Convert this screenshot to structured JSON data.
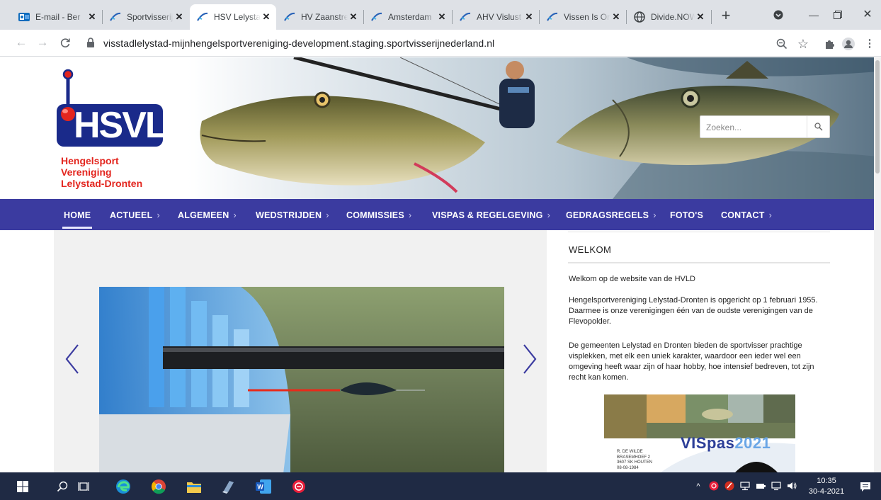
{
  "browser": {
    "tabs": [
      {
        "title": "E-mail - Ber",
        "icon": "outlook-icon"
      },
      {
        "title": "Sportvisserij",
        "icon": "sportvisserij-icon"
      },
      {
        "title": "HSV Lelysta",
        "icon": "sportvisserij-icon",
        "active": true
      },
      {
        "title": "HV Zaanstre",
        "icon": "sportvisserij-icon"
      },
      {
        "title": "Amsterdam",
        "icon": "sportvisserij-icon"
      },
      {
        "title": "AHV Vislust",
        "icon": "sportvisserij-icon"
      },
      {
        "title": "Vissen Is On",
        "icon": "sportvisserij-icon"
      },
      {
        "title": "Divide.NOW",
        "icon": "globe-icon"
      }
    ],
    "new_tab": "+",
    "url": "visstadlelystad-mijnhengelsportvereniging-development.staging.sportvisserijnederland.nl"
  },
  "site": {
    "logo": {
      "letters": "HSVL",
      "line1": "Hengelsport",
      "line2": "Vereniging",
      "line3": "Lelystad-Dronten"
    },
    "search": {
      "placeholder": "Zoeken..."
    },
    "nav": [
      {
        "label": "HOME",
        "has_children": false,
        "active": true
      },
      {
        "label": "ACTUEEL",
        "has_children": true
      },
      {
        "label": "ALGEMEEN",
        "has_children": true
      },
      {
        "label": "WEDSTRIJDEN",
        "has_children": true
      },
      {
        "label": "COMMISSIES",
        "has_children": true
      },
      {
        "label": "VISPAS & REGELGEVING",
        "has_children": true
      },
      {
        "label": "GEDRAGSREGELS",
        "has_children": true
      },
      {
        "label": "FOTO'S",
        "has_children": false
      },
      {
        "label": "CONTACT",
        "has_children": true
      }
    ],
    "nav_chevron": "›",
    "sidebar": {
      "title": "WELKOM",
      "p1": "Welkom op de website van de HVLD",
      "p2": "Hengelsportvereniging Lelystad-Dronten is opgericht op 1 februari 1955. Daarmee is onze verenigingen één van de oudste verenigingen van de Flevopolder.",
      "p3": "De gemeenten Lelystad en Dronten bieden de sportvisser prachtige visplekken, met elk een uniek karakter, waardoor een ieder wel een omgeving heeft waar zijn of haar hobby, hoe intensief bedreven, tot zijn recht kan komen.",
      "vispas": {
        "title_vis": "VISpas",
        "title_year": "2021",
        "holder": [
          "R. DE WILDE",
          "BRASEMHOEF 2",
          "3607 SK  HOUTEN",
          "08-08-1984"
        ]
      }
    },
    "colors": {
      "nav": "#3b3ba0",
      "logo_blue": "#1a2a8a",
      "logo_red": "#e3261f"
    }
  },
  "taskbar": {
    "time": "10:35",
    "date": "30-4-2021"
  }
}
